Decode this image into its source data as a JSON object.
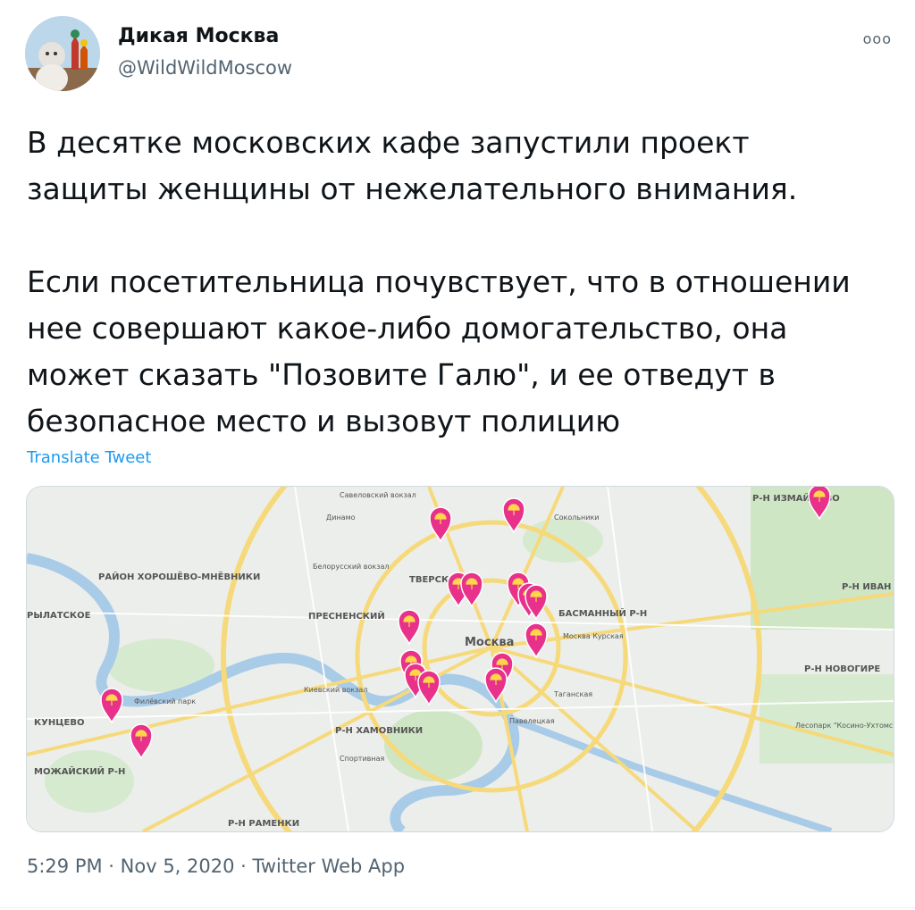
{
  "author": {
    "name": "Дикая Москва",
    "handle": "@WildWildMoscow"
  },
  "more_label": "ooo",
  "tweet": {
    "paragraph1_line1": "В десятке московских кафе запустили проект",
    "paragraph1_line2": "защиты женщины от нежелательного внимания.",
    "paragraph2_line1": "Если посетительница почувствует, что в отношении",
    "paragraph2_line2": "нее совершают какое-либо домогательство, она",
    "paragraph2_line3": "может сказать \"Позовите Галю\", и ее отведут в",
    "paragraph2_line4": "безопасное место и вызовут полицию"
  },
  "translate_label": "Translate Tweet",
  "map": {
    "pin_color": "#e8318a",
    "labels": {
      "moskva": "Москва",
      "tverskoy": "ТВЕРСКОЙ",
      "presnensky": "ПРЕСНЕНСКИЙ",
      "khamovniki": "Р-Н ХАМОВНИКИ",
      "basmanny": "БАСМАННЫЙ Р-Н",
      "kuntsevo": "КУНЦЕВО",
      "mozhaisky": "МОЖАЙСКИЙ Р-Н",
      "ramenki": "Р-Н РАМЕНКИ",
      "izmaylovo": "Р-Н ИЗМАЙЛОВО",
      "khoroshevo": "РАЙОН ХОРОШЁВО-МНЁВНИКИ",
      "krylatskoe": "РЫЛАТСКОЕ",
      "novogireevo": "Р-Н НОВОГИРЕ",
      "ivan": "Р-Н ИВАН",
      "savelovsky": "Савеловский вокзал",
      "dinamo": "Динамо",
      "belorussky": "Белорусский вокзал",
      "kievsky": "Киевский вокзал",
      "kurskaya": "Москва Курская",
      "taganskaya": "Таганская",
      "sokolniki": "Сокольники",
      "paveletskaya": "Павелецкая",
      "sportivnaya": "Спортивная",
      "fili": "Филёвский парк",
      "lesopark": "Лесопарк \"Косино-Ухтомский\""
    }
  },
  "meta": {
    "time": "5:29 PM",
    "date": "Nov 5, 2020",
    "source": "Twitter Web App",
    "separator": " · "
  }
}
